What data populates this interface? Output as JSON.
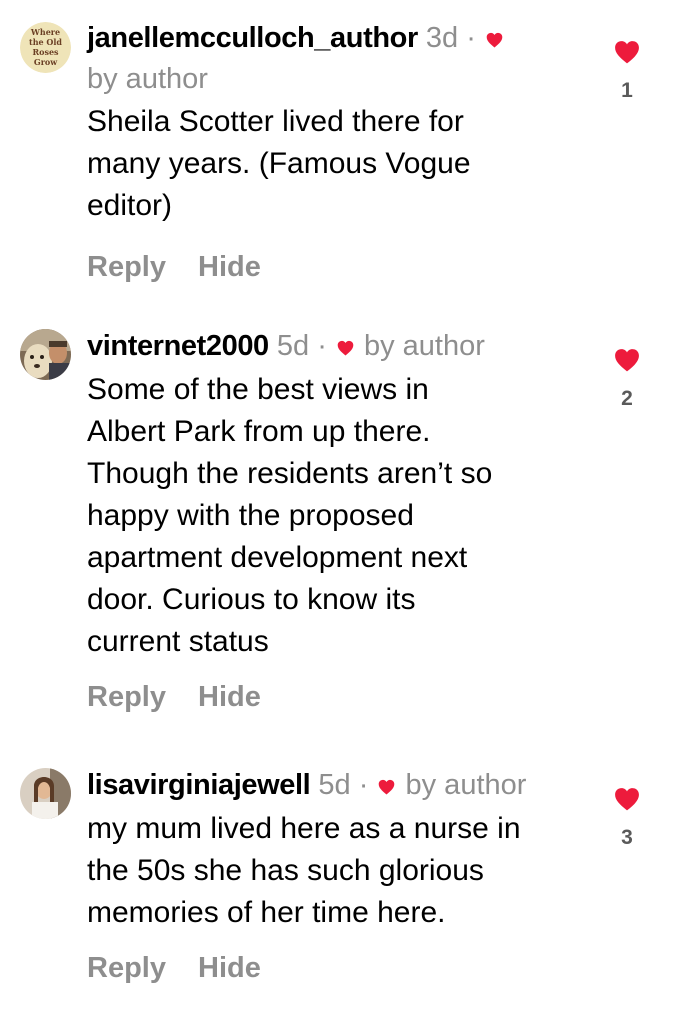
{
  "colors": {
    "heart": "#ed1b3c",
    "meta_gray": "#8e8e8e",
    "text": "#000000"
  },
  "comments": [
    {
      "username": "janellemcculloch_author",
      "time": "3d",
      "separator": "·",
      "byline": "by author",
      "avatar_text": [
        "Where",
        "the Old",
        "Roses",
        "Grow"
      ],
      "text_lines": [
        "Sheila  Scotter lived there for",
        "many years. (Famous Vogue",
        "editor)"
      ],
      "reply_label": "Reply",
      "hide_label": "Hide",
      "like_count": "1",
      "heart_icon": "heart-icon"
    },
    {
      "username": "vinternet2000",
      "time": "5d",
      "separator": "·",
      "byline": "by author",
      "text_lines": [
        "Some of the best views in",
        "Albert Park from up there.",
        "Though the residents aren’t so",
        "happy with the proposed",
        "apartment development next",
        "door. Curious to know its",
        "current status"
      ],
      "reply_label": "Reply",
      "hide_label": "Hide",
      "like_count": "2",
      "heart_icon": "heart-icon"
    },
    {
      "username": "lisavirginiajewell",
      "time": "5d",
      "separator": "·",
      "byline": "by author",
      "text_lines": [
        "my mum lived here as a nurse in",
        "the 50s she has such glorious",
        "memories of her time here."
      ],
      "reply_label": "Reply",
      "hide_label": "Hide",
      "like_count": "3",
      "heart_icon": "heart-icon"
    }
  ]
}
